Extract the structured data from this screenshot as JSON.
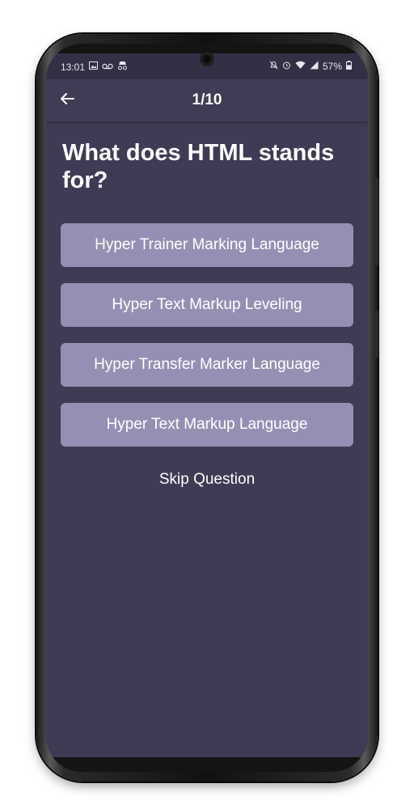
{
  "status_bar": {
    "time": "13:01",
    "battery": "57%",
    "left_icons": [
      "image-icon",
      "voicemail-icon",
      "incognito-icon"
    ],
    "right_icons": [
      "mute-icon",
      "alarm-icon",
      "wifi-icon",
      "signal-icon",
      "battery-icon"
    ]
  },
  "app_bar": {
    "back_icon": "arrow-left-icon",
    "title": "1/10"
  },
  "question": {
    "text": "What does HTML stands for?"
  },
  "options": [
    {
      "label": "Hyper Trainer Marking Language"
    },
    {
      "label": "Hyper Text Markup Leveling"
    },
    {
      "label": "Hyper Transfer Marker Language"
    },
    {
      "label": "Hyper Text Markup Language"
    }
  ],
  "skip": {
    "label": "Skip Question"
  },
  "colors": {
    "background": "#3e3b54",
    "app_bar": "#3f3c55",
    "option": "#9590b3",
    "text": "#ffffff"
  }
}
